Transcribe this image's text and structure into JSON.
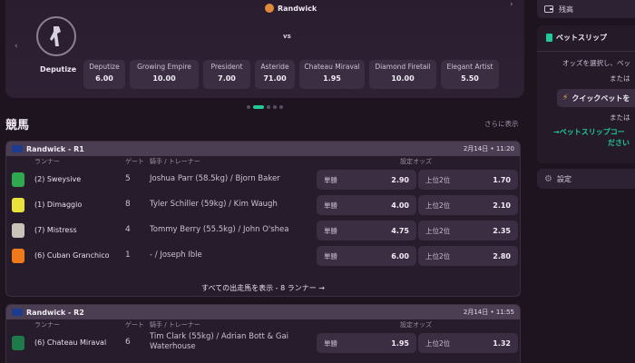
{
  "hero": {
    "venue": "Randwick",
    "vs": "vs",
    "first_runner": "Deputize",
    "odds": [
      {
        "name": "Deputize",
        "value": "6.00"
      },
      {
        "name": "Growing Empire",
        "value": "10.00"
      },
      {
        "name": "President",
        "value": "7.00"
      },
      {
        "name": "Asteride",
        "value": "71.00"
      },
      {
        "name": "Chateau Miraval",
        "value": "1.95"
      },
      {
        "name": "Diamond Firetail",
        "value": "10.00"
      },
      {
        "name": "Elegant Artist",
        "value": "5.50"
      }
    ],
    "prev_arrow": "‹",
    "next_arrow": "›"
  },
  "section": {
    "title": "競馬",
    "see_more": "さらに表示"
  },
  "columns": {
    "runner": "ランナー",
    "gate": "ゲート",
    "jockey": "騎手 / トレーナー",
    "odds": "設定オッズ"
  },
  "bet_labels": {
    "win": "単勝",
    "place": "上位2位"
  },
  "races": [
    {
      "name": "Randwick - R1",
      "time": "2月14日 • 11:20",
      "runners": [
        {
          "name": "(2) Sweysive",
          "gate": "5",
          "jockey": "Joshua Parr (58.5kg) / Bjorn Baker",
          "win": "2.90",
          "place": "1.70",
          "silk_color": "#2fa84f"
        },
        {
          "name": "(1) Dimaggio",
          "gate": "8",
          "jockey": "Tyler Schiller (59kg) / Kim Waugh",
          "win": "4.00",
          "place": "2.10",
          "silk_color": "#e9e23a"
        },
        {
          "name": "(7) Mistress",
          "gate": "4",
          "jockey": "Tommy Berry (55.5kg) / John O'shea",
          "win": "4.75",
          "place": "2.35",
          "silk_color": "#c9c2b8"
        },
        {
          "name": "(6) Cuban Granchico",
          "gate": "1",
          "jockey": "- / Joseph Ible",
          "win": "6.00",
          "place": "2.80",
          "silk_color": "#f07a1a"
        }
      ],
      "show_all": "すべての出走馬を表示 - 8 ランナー →"
    },
    {
      "name": "Randwick - R2",
      "time": "2月14日 • 11:55",
      "runners": [
        {
          "name": "(6) Chateau Miraval",
          "gate": "6",
          "jockey_line1": "Tim Clark (55kg) / Adrian Bott & Gai",
          "jockey_line2": "Waterhouse",
          "win": "1.95",
          "place": "1.32",
          "silk_color": "#1f7a4a"
        }
      ]
    }
  ],
  "sidebar": {
    "balance": "残高",
    "betslip_title": "ベットスリップ",
    "instruction": "オッズを選択し、ベッ",
    "or1": "または",
    "quick_bet": "クイックベットを",
    "or2": "または",
    "code_line1": "→ベットスリップコー",
    "code_line2": "ださい",
    "settings": "設定"
  },
  "colors": {
    "accent": "#20c997",
    "background": "#1d1420",
    "card": "#3b2e42"
  },
  "icons": {
    "venue": "horse-racing-icon",
    "balance": "wallet-icon",
    "betslip": "ticket-icon",
    "quick_bet": "lightning-icon",
    "settings": "gear-icon"
  }
}
